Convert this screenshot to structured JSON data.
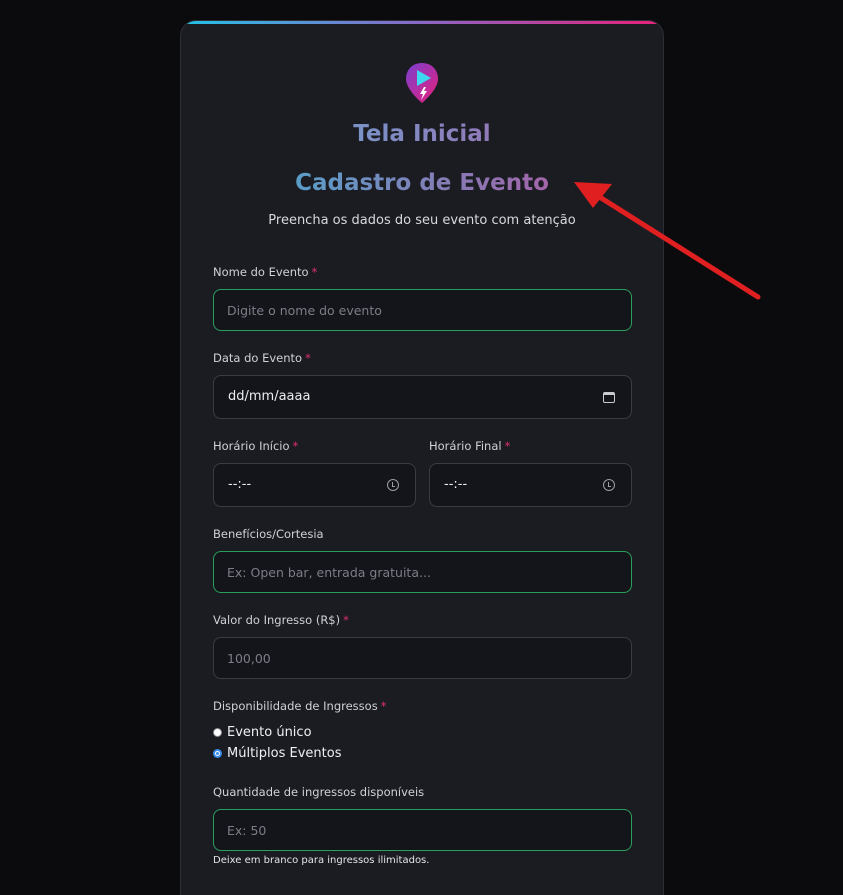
{
  "app": {
    "title": "Tela Inicial"
  },
  "form": {
    "title": "Cadastro de Evento",
    "subtitle": "Preencha os dados do seu evento com atenção",
    "required_mark": "*",
    "event_name": {
      "label": "Nome do Evento",
      "placeholder": "Digite o nome do evento"
    },
    "event_date": {
      "label": "Data do Evento",
      "value": "dd/mm/aaaa"
    },
    "start_time": {
      "label": "Horário Início",
      "value": "--:--"
    },
    "end_time": {
      "label": "Horário Final",
      "value": "--:--"
    },
    "benefits": {
      "label": "Benefícios/Cortesia",
      "placeholder": "Ex: Open bar, entrada gratuita..."
    },
    "price": {
      "label": "Valor do Ingresso (R$)",
      "placeholder": "100,00"
    },
    "availability": {
      "label": "Disponibilidade de Ingressos",
      "options": [
        {
          "label": "Evento único",
          "checked": false
        },
        {
          "label": "Múltiplos Eventos",
          "checked": true
        }
      ]
    },
    "quantity": {
      "label": "Quantidade de ingressos disponíveis",
      "placeholder": "Ex: 50",
      "hint": "Deixe em branco para ingressos ilimitados."
    }
  },
  "colors": {
    "accent_cyan": "#22c3e6",
    "accent_pink": "#e8207a",
    "field_border_valid": "#2a9e5c",
    "required": "#e0306a",
    "annotation_arrow": "#e02020"
  },
  "icons": {
    "logo": "location-pin-play-icon",
    "date": "calendar-icon",
    "time": "clock-icon"
  }
}
